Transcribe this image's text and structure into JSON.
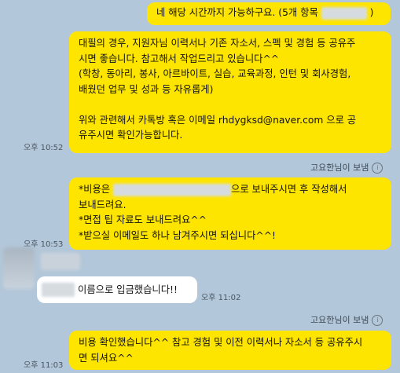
{
  "messages": {
    "m1": {
      "text_before": "네 해당 시간까지 가능하구요. (5개 항목",
      "text_after": ")"
    },
    "m2": {
      "lines": [
        "대필의 경우, 지원자님 이력서나 기존 자소서, 스펙 및 경험 등 공유주",
        "시면 좋습니다. 참고해서 작업드리고 있습니다^^",
        "(학창, 동아리, 봉사, 아르바이트, 실습, 교육과정, 인턴 및 회사경험,",
        "배웠던 업무 및 성과 등 자유롭게)",
        "",
        "위와 관련해서 카톡방 혹은 이메일 rhdygksd@naver.com 으로 공",
        "유주시면 확인가능합니다."
      ],
      "time": "오후 10:52"
    },
    "sent_label_1": "고요한님이 보냄",
    "m3": {
      "line1_before": "*비용은",
      "line1_after": "으로 보내주시면 후 작성해서",
      "lines": [
        "보내드려요.",
        "*면접 팁 자료도 보내드려요^^",
        "*받으실 이메일도 하나 남겨주시면 되십니다^^!"
      ],
      "time": "오후 10:53"
    },
    "reply": {
      "text": "이름으로 입금했습니다!!",
      "time": "오후 11:02"
    },
    "sent_label_2": "고요한님이 보냄",
    "m4": {
      "lines": [
        "비용 확인했습니다^^ 참고 경험 및 이전 이력서나 자소서 등 공유주시",
        "면 되셔요^^"
      ],
      "time": "오후 11:03"
    }
  },
  "colors": {
    "background": "#b2c7d9",
    "my_bubble": "#fee500",
    "their_bubble": "#ffffff"
  }
}
